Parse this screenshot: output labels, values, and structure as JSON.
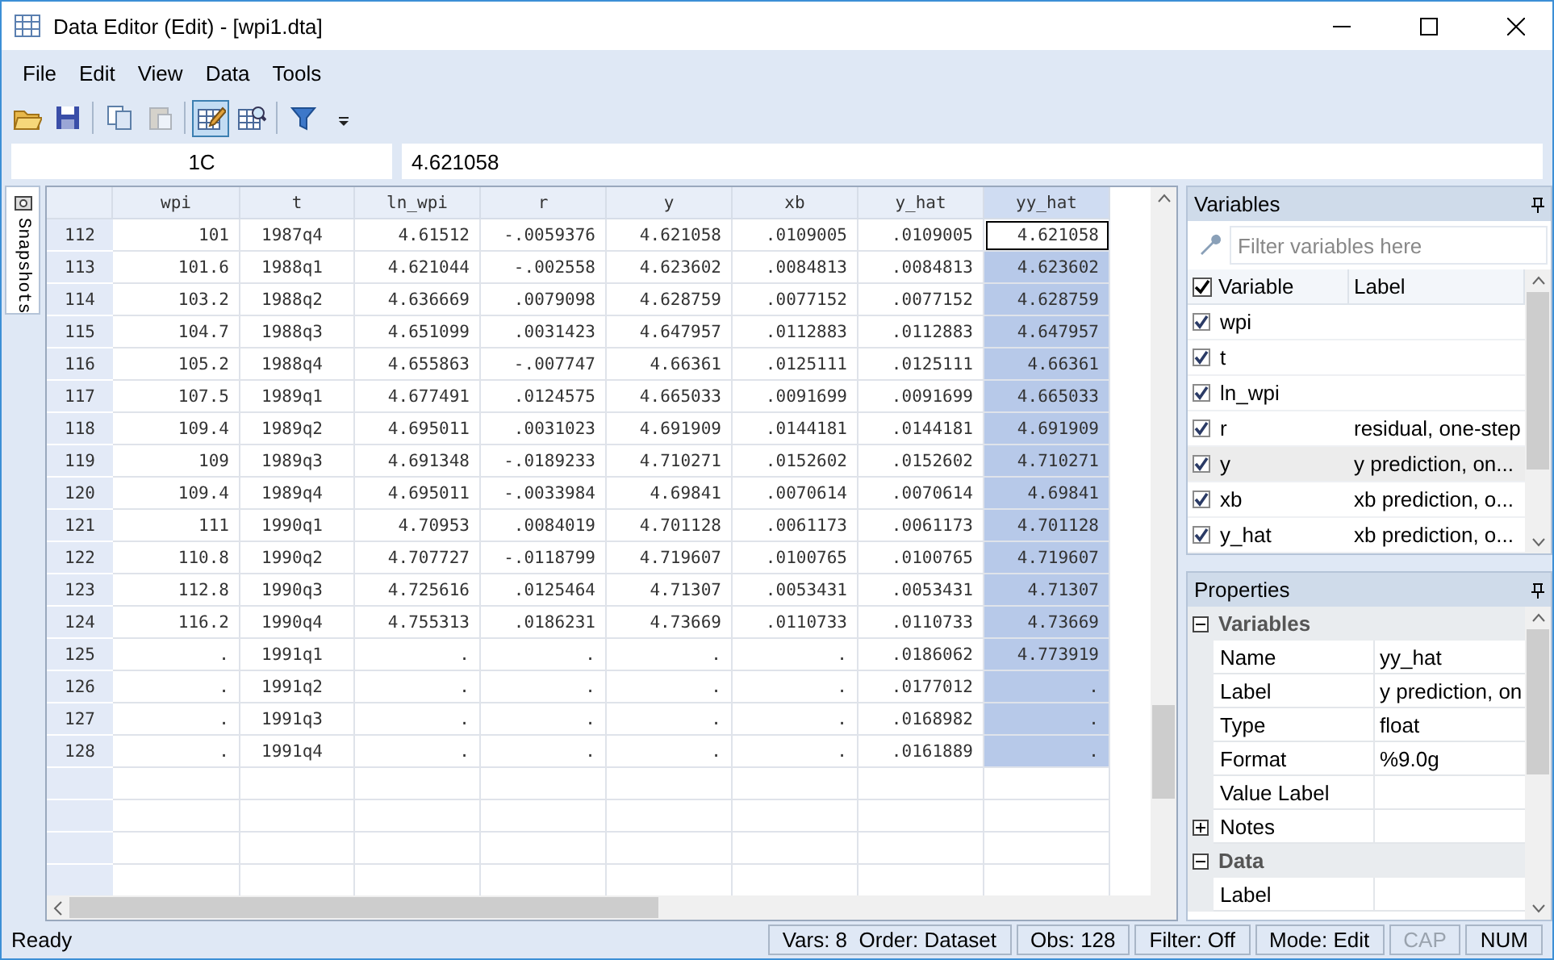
{
  "window": {
    "title": "Data Editor (Edit) - [wpi1.dta]"
  },
  "menu": [
    "File",
    "Edit",
    "View",
    "Data",
    "Tools"
  ],
  "toolbar": [
    {
      "kind": "open",
      "pressed": false,
      "disabled": false
    },
    {
      "kind": "save",
      "pressed": false,
      "disabled": false
    },
    {
      "kind": "sep"
    },
    {
      "kind": "copy",
      "pressed": false,
      "disabled": false
    },
    {
      "kind": "paste",
      "pressed": false,
      "disabled": true
    },
    {
      "kind": "sep"
    },
    {
      "kind": "edit",
      "pressed": true,
      "disabled": false
    },
    {
      "kind": "browse",
      "pressed": false,
      "disabled": false
    },
    {
      "kind": "sep"
    },
    {
      "kind": "filter",
      "pressed": false,
      "disabled": false
    },
    {
      "kind": "more",
      "pressed": false,
      "disabled": false
    }
  ],
  "cell_bar": {
    "reference": "1C",
    "value": "4.621058"
  },
  "side_tab": "Snapshots",
  "grid": {
    "columns": [
      "wpi",
      "t",
      "ln_wpi",
      "r",
      "y",
      "xb",
      "y_hat",
      "yy_hat"
    ],
    "rows": [
      {
        "obs": "112",
        "cells": [
          "101",
          "1987q4",
          "4.61512",
          "-.0059376",
          "4.621058",
          ".0109005",
          ".0109005",
          "4.621058"
        ],
        "selected": false,
        "current": true
      },
      {
        "obs": "113",
        "cells": [
          "101.6",
          "1988q1",
          "4.621044",
          "-.002558",
          "4.623602",
          ".0084813",
          ".0084813",
          "4.623602"
        ],
        "selected": true,
        "current": false
      },
      {
        "obs": "114",
        "cells": [
          "103.2",
          "1988q2",
          "4.636669",
          ".0079098",
          "4.628759",
          ".0077152",
          ".0077152",
          "4.628759"
        ],
        "selected": true,
        "current": false
      },
      {
        "obs": "115",
        "cells": [
          "104.7",
          "1988q3",
          "4.651099",
          ".0031423",
          "4.647957",
          ".0112883",
          ".0112883",
          "4.647957"
        ],
        "selected": true,
        "current": false
      },
      {
        "obs": "116",
        "cells": [
          "105.2",
          "1988q4",
          "4.655863",
          "-.007747",
          "4.66361",
          ".0125111",
          ".0125111",
          "4.66361"
        ],
        "selected": true,
        "current": false
      },
      {
        "obs": "117",
        "cells": [
          "107.5",
          "1989q1",
          "4.677491",
          ".0124575",
          "4.665033",
          ".0091699",
          ".0091699",
          "4.665033"
        ],
        "selected": true,
        "current": false
      },
      {
        "obs": "118",
        "cells": [
          "109.4",
          "1989q2",
          "4.695011",
          ".0031023",
          "4.691909",
          ".0144181",
          ".0144181",
          "4.691909"
        ],
        "selected": true,
        "current": false
      },
      {
        "obs": "119",
        "cells": [
          "109",
          "1989q3",
          "4.691348",
          "-.0189233",
          "4.710271",
          ".0152602",
          ".0152602",
          "4.710271"
        ],
        "selected": true,
        "current": false
      },
      {
        "obs": "120",
        "cells": [
          "109.4",
          "1989q4",
          "4.695011",
          "-.0033984",
          "4.69841",
          ".0070614",
          ".0070614",
          "4.69841"
        ],
        "selected": true,
        "current": false
      },
      {
        "obs": "121",
        "cells": [
          "111",
          "1990q1",
          "4.70953",
          ".0084019",
          "4.701128",
          ".0061173",
          ".0061173",
          "4.701128"
        ],
        "selected": true,
        "current": false
      },
      {
        "obs": "122",
        "cells": [
          "110.8",
          "1990q2",
          "4.707727",
          "-.0118799",
          "4.719607",
          ".0100765",
          ".0100765",
          "4.719607"
        ],
        "selected": true,
        "current": false
      },
      {
        "obs": "123",
        "cells": [
          "112.8",
          "1990q3",
          "4.725616",
          ".0125464",
          "4.71307",
          ".0053431",
          ".0053431",
          "4.71307"
        ],
        "selected": true,
        "current": false
      },
      {
        "obs": "124",
        "cells": [
          "116.2",
          "1990q4",
          "4.755313",
          ".0186231",
          "4.73669",
          ".0110733",
          ".0110733",
          "4.73669"
        ],
        "selected": true,
        "current": false
      },
      {
        "obs": "125",
        "cells": [
          ".",
          "1991q1",
          ".",
          ".",
          ".",
          ".",
          ".0186062",
          "4.773919"
        ],
        "selected": true,
        "current": false
      },
      {
        "obs": "126",
        "cells": [
          ".",
          "1991q2",
          ".",
          ".",
          ".",
          ".",
          ".0177012",
          "."
        ],
        "selected": true,
        "current": false
      },
      {
        "obs": "127",
        "cells": [
          ".",
          "1991q3",
          ".",
          ".",
          ".",
          ".",
          ".0168982",
          "."
        ],
        "selected": true,
        "current": false
      },
      {
        "obs": "128",
        "cells": [
          ".",
          "1991q4",
          ".",
          ".",
          ".",
          ".",
          ".0161889",
          "."
        ],
        "selected": true,
        "current": false
      }
    ]
  },
  "variables_panel": {
    "title": "Variables",
    "filter_placeholder": "Filter variables here",
    "all_checked": true,
    "columns": [
      "Variable",
      "Label"
    ],
    "items": [
      {
        "name": "wpi",
        "checked": true,
        "selected": false
      },
      {
        "name": "t",
        "checked": true,
        "selected": false
      },
      {
        "name": "ln_wpi",
        "checked": true,
        "selected": false
      },
      {
        "name": "r",
        "label": "residual, one-step",
        "checked": true,
        "selected": false
      },
      {
        "name": "y",
        "label": "y prediction, on...",
        "checked": true,
        "selected": true
      },
      {
        "name": "xb",
        "label": "xb prediction, o...",
        "checked": true,
        "selected": false
      },
      {
        "name": "y_hat",
        "label": "xb prediction, o...",
        "checked": true,
        "selected": false
      }
    ]
  },
  "properties_panel": {
    "title": "Properties",
    "groups": [
      {
        "title": "Variables",
        "expanded": true,
        "items": [
          {
            "name": "Name",
            "value": "yy_hat"
          },
          {
            "name": "Label",
            "value": "y prediction, on"
          },
          {
            "name": "Type",
            "value": "float"
          },
          {
            "name": "Format",
            "value": "%9.0g"
          },
          {
            "name": "Value Label"
          },
          {
            "name": "Notes",
            "expandable": true
          }
        ]
      },
      {
        "title": "Data",
        "expanded": true,
        "items": [
          {
            "name": "Label"
          }
        ]
      }
    ]
  },
  "status_bar": {
    "message": "Ready",
    "panes": [
      {
        "text": "Vars: 8  Order: Dataset",
        "disabled": false
      },
      {
        "text": "Obs: 128",
        "disabled": false
      },
      {
        "text": "Filter: Off",
        "disabled": false
      },
      {
        "text": "Mode: Edit",
        "disabled": false
      },
      {
        "text": "CAP",
        "disabled": true
      },
      {
        "text": "NUM",
        "disabled": false
      }
    ]
  }
}
